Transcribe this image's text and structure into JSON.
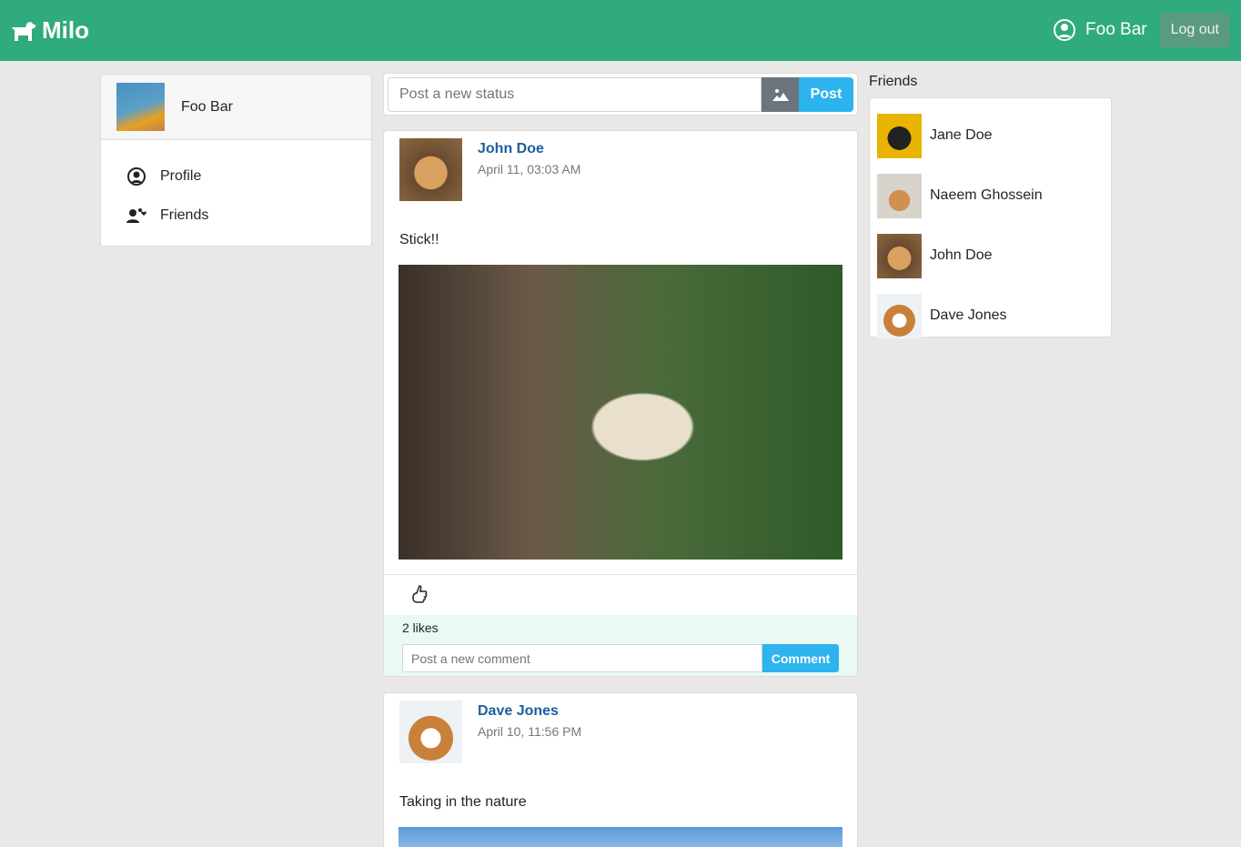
{
  "header": {
    "brand": "Milo",
    "user_name": "Foo Bar",
    "logout_label": "Log out",
    "accent": "#2fab7e"
  },
  "sidebar": {
    "user_name": "Foo Bar",
    "items": [
      {
        "label": "Profile",
        "icon": "user-circle-icon"
      },
      {
        "label": "Friends",
        "icon": "user-friends-icon"
      }
    ]
  },
  "composer": {
    "placeholder": "Post a new status",
    "post_label": "Post"
  },
  "posts": [
    {
      "author": "John Doe",
      "date": "April 11, 03:03 AM",
      "text": "Stick!!",
      "likes": "2 likes",
      "comment_placeholder": "Post a new comment",
      "comment_label": "Comment"
    },
    {
      "author": "Dave Jones",
      "date": "April 10, 11:56 PM",
      "text": "Taking in the nature"
    }
  ],
  "friends": {
    "title": "Friends",
    "items": [
      "Jane Doe",
      "Naeem Ghossein",
      "John Doe",
      "Dave Jones"
    ]
  }
}
